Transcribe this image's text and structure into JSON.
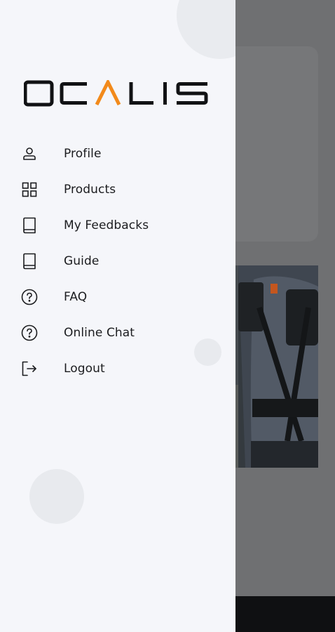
{
  "brand": {
    "logo_text": "OCALIS",
    "accent_color": "#f28a1b",
    "text_color": "#111214"
  },
  "drawer": {
    "menu": [
      {
        "label": "Profile",
        "icon": "user-icon"
      },
      {
        "label": "Products",
        "icon": "grid-icon"
      },
      {
        "label": "My Feedbacks",
        "icon": "book-icon"
      },
      {
        "label": "Guide",
        "icon": "book-icon"
      },
      {
        "label": "FAQ",
        "icon": "help-circle-icon"
      },
      {
        "label": "Online Chat",
        "icon": "help-circle-icon"
      },
      {
        "label": "Logout",
        "icon": "logout-icon"
      }
    ]
  },
  "colors": {
    "drawer_bg": "#f5f6fa",
    "overlay_bg": "#6f7072",
    "bottom_bar": "#0f1012"
  }
}
